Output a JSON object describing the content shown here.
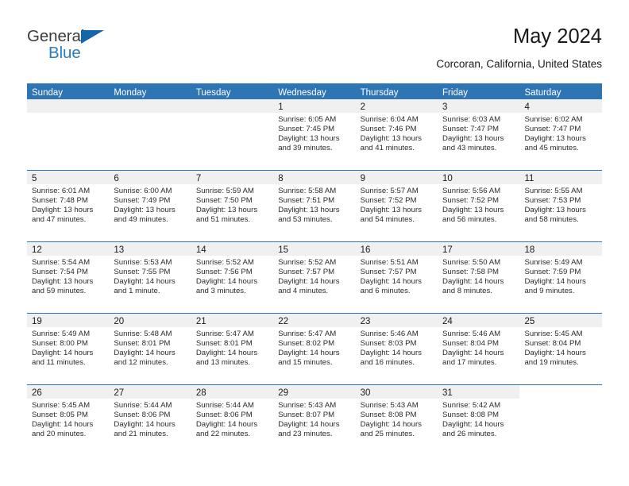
{
  "brand": {
    "name_top": "General",
    "name_bottom": "Blue",
    "triangle_icon": "triangle-logo-icon",
    "color_blue": "#2b7cc0",
    "color_triangle": "#1565a8",
    "color_gray": "#3c3c3c"
  },
  "header": {
    "month_title": "May 2024",
    "location": "Corcoran, California, United States"
  },
  "theme": {
    "header_blue": "#2e75b6",
    "daynum_band": "#f0f0f0",
    "text": "#1a1a1a"
  },
  "calendar": {
    "weekday_headers": [
      "Sunday",
      "Monday",
      "Tuesday",
      "Wednesday",
      "Thursday",
      "Friday",
      "Saturday"
    ],
    "weeks": [
      [
        {
          "blank": true
        },
        {
          "blank": true
        },
        {
          "blank": true
        },
        {
          "day": "1",
          "sunrise": "Sunrise: 6:05 AM",
          "sunset": "Sunset: 7:45 PM",
          "daylight_1": "Daylight: 13 hours",
          "daylight_2": "and 39 minutes."
        },
        {
          "day": "2",
          "sunrise": "Sunrise: 6:04 AM",
          "sunset": "Sunset: 7:46 PM",
          "daylight_1": "Daylight: 13 hours",
          "daylight_2": "and 41 minutes."
        },
        {
          "day": "3",
          "sunrise": "Sunrise: 6:03 AM",
          "sunset": "Sunset: 7:47 PM",
          "daylight_1": "Daylight: 13 hours",
          "daylight_2": "and 43 minutes."
        },
        {
          "day": "4",
          "sunrise": "Sunrise: 6:02 AM",
          "sunset": "Sunset: 7:47 PM",
          "daylight_1": "Daylight: 13 hours",
          "daylight_2": "and 45 minutes."
        }
      ],
      [
        {
          "day": "5",
          "sunrise": "Sunrise: 6:01 AM",
          "sunset": "Sunset: 7:48 PM",
          "daylight_1": "Daylight: 13 hours",
          "daylight_2": "and 47 minutes."
        },
        {
          "day": "6",
          "sunrise": "Sunrise: 6:00 AM",
          "sunset": "Sunset: 7:49 PM",
          "daylight_1": "Daylight: 13 hours",
          "daylight_2": "and 49 minutes."
        },
        {
          "day": "7",
          "sunrise": "Sunrise: 5:59 AM",
          "sunset": "Sunset: 7:50 PM",
          "daylight_1": "Daylight: 13 hours",
          "daylight_2": "and 51 minutes."
        },
        {
          "day": "8",
          "sunrise": "Sunrise: 5:58 AM",
          "sunset": "Sunset: 7:51 PM",
          "daylight_1": "Daylight: 13 hours",
          "daylight_2": "and 53 minutes."
        },
        {
          "day": "9",
          "sunrise": "Sunrise: 5:57 AM",
          "sunset": "Sunset: 7:52 PM",
          "daylight_1": "Daylight: 13 hours",
          "daylight_2": "and 54 minutes."
        },
        {
          "day": "10",
          "sunrise": "Sunrise: 5:56 AM",
          "sunset": "Sunset: 7:52 PM",
          "daylight_1": "Daylight: 13 hours",
          "daylight_2": "and 56 minutes."
        },
        {
          "day": "11",
          "sunrise": "Sunrise: 5:55 AM",
          "sunset": "Sunset: 7:53 PM",
          "daylight_1": "Daylight: 13 hours",
          "daylight_2": "and 58 minutes."
        }
      ],
      [
        {
          "day": "12",
          "sunrise": "Sunrise: 5:54 AM",
          "sunset": "Sunset: 7:54 PM",
          "daylight_1": "Daylight: 13 hours",
          "daylight_2": "and 59 minutes."
        },
        {
          "day": "13",
          "sunrise": "Sunrise: 5:53 AM",
          "sunset": "Sunset: 7:55 PM",
          "daylight_1": "Daylight: 14 hours",
          "daylight_2": "and 1 minute."
        },
        {
          "day": "14",
          "sunrise": "Sunrise: 5:52 AM",
          "sunset": "Sunset: 7:56 PM",
          "daylight_1": "Daylight: 14 hours",
          "daylight_2": "and 3 minutes."
        },
        {
          "day": "15",
          "sunrise": "Sunrise: 5:52 AM",
          "sunset": "Sunset: 7:57 PM",
          "daylight_1": "Daylight: 14 hours",
          "daylight_2": "and 4 minutes."
        },
        {
          "day": "16",
          "sunrise": "Sunrise: 5:51 AM",
          "sunset": "Sunset: 7:57 PM",
          "daylight_1": "Daylight: 14 hours",
          "daylight_2": "and 6 minutes."
        },
        {
          "day": "17",
          "sunrise": "Sunrise: 5:50 AM",
          "sunset": "Sunset: 7:58 PM",
          "daylight_1": "Daylight: 14 hours",
          "daylight_2": "and 8 minutes."
        },
        {
          "day": "18",
          "sunrise": "Sunrise: 5:49 AM",
          "sunset": "Sunset: 7:59 PM",
          "daylight_1": "Daylight: 14 hours",
          "daylight_2": "and 9 minutes."
        }
      ],
      [
        {
          "day": "19",
          "sunrise": "Sunrise: 5:49 AM",
          "sunset": "Sunset: 8:00 PM",
          "daylight_1": "Daylight: 14 hours",
          "daylight_2": "and 11 minutes."
        },
        {
          "day": "20",
          "sunrise": "Sunrise: 5:48 AM",
          "sunset": "Sunset: 8:01 PM",
          "daylight_1": "Daylight: 14 hours",
          "daylight_2": "and 12 minutes."
        },
        {
          "day": "21",
          "sunrise": "Sunrise: 5:47 AM",
          "sunset": "Sunset: 8:01 PM",
          "daylight_1": "Daylight: 14 hours",
          "daylight_2": "and 13 minutes."
        },
        {
          "day": "22",
          "sunrise": "Sunrise: 5:47 AM",
          "sunset": "Sunset: 8:02 PM",
          "daylight_1": "Daylight: 14 hours",
          "daylight_2": "and 15 minutes."
        },
        {
          "day": "23",
          "sunrise": "Sunrise: 5:46 AM",
          "sunset": "Sunset: 8:03 PM",
          "daylight_1": "Daylight: 14 hours",
          "daylight_2": "and 16 minutes."
        },
        {
          "day": "24",
          "sunrise": "Sunrise: 5:46 AM",
          "sunset": "Sunset: 8:04 PM",
          "daylight_1": "Daylight: 14 hours",
          "daylight_2": "and 17 minutes."
        },
        {
          "day": "25",
          "sunrise": "Sunrise: 5:45 AM",
          "sunset": "Sunset: 8:04 PM",
          "daylight_1": "Daylight: 14 hours",
          "daylight_2": "and 19 minutes."
        }
      ],
      [
        {
          "day": "26",
          "sunrise": "Sunrise: 5:45 AM",
          "sunset": "Sunset: 8:05 PM",
          "daylight_1": "Daylight: 14 hours",
          "daylight_2": "and 20 minutes."
        },
        {
          "day": "27",
          "sunrise": "Sunrise: 5:44 AM",
          "sunset": "Sunset: 8:06 PM",
          "daylight_1": "Daylight: 14 hours",
          "daylight_2": "and 21 minutes."
        },
        {
          "day": "28",
          "sunrise": "Sunrise: 5:44 AM",
          "sunset": "Sunset: 8:06 PM",
          "daylight_1": "Daylight: 14 hours",
          "daylight_2": "and 22 minutes."
        },
        {
          "day": "29",
          "sunrise": "Sunrise: 5:43 AM",
          "sunset": "Sunset: 8:07 PM",
          "daylight_1": "Daylight: 14 hours",
          "daylight_2": "and 23 minutes."
        },
        {
          "day": "30",
          "sunrise": "Sunrise: 5:43 AM",
          "sunset": "Sunset: 8:08 PM",
          "daylight_1": "Daylight: 14 hours",
          "daylight_2": "and 25 minutes."
        },
        {
          "day": "31",
          "sunrise": "Sunrise: 5:42 AM",
          "sunset": "Sunset: 8:08 PM",
          "daylight_1": "Daylight: 14 hours",
          "daylight_2": "and 26 minutes."
        },
        {
          "empty_tail": true
        }
      ]
    ]
  }
}
